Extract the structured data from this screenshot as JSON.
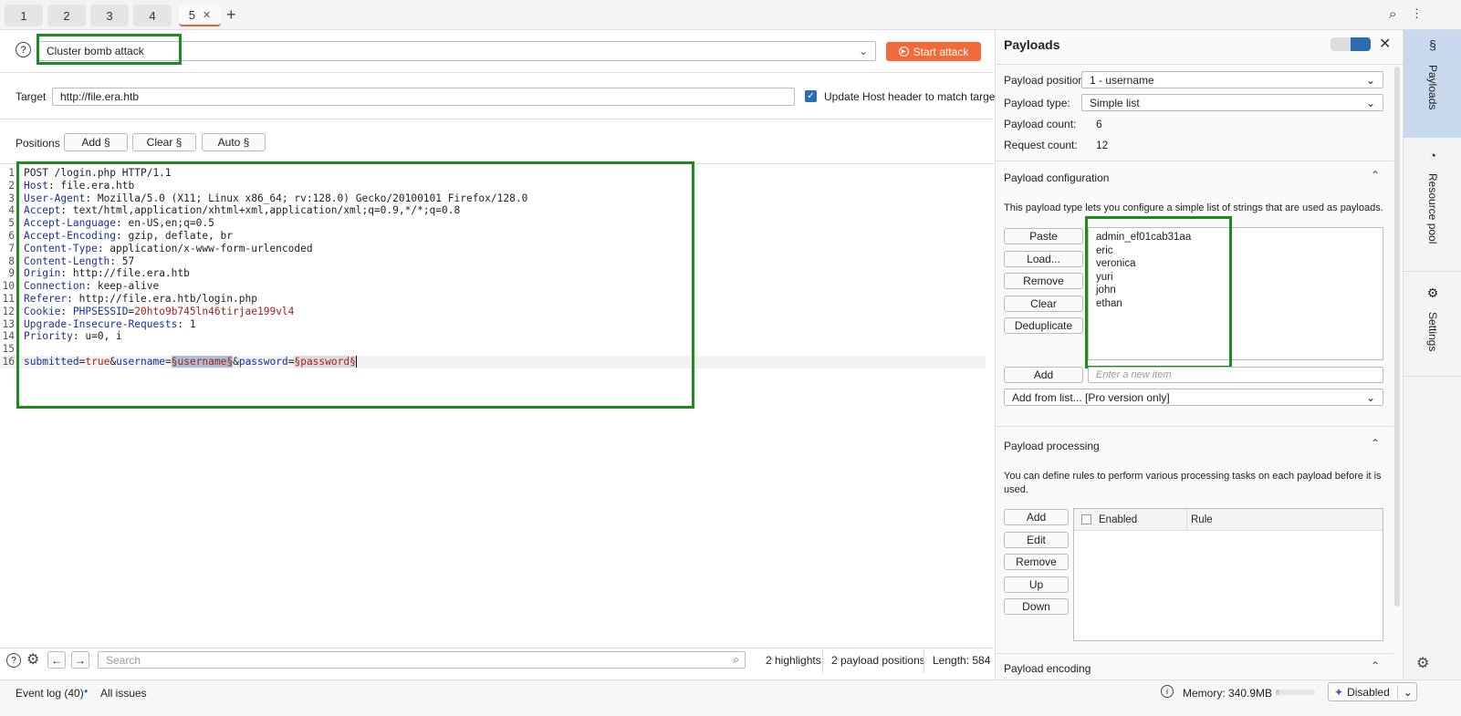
{
  "tabs": [
    {
      "label": "1"
    },
    {
      "label": "2"
    },
    {
      "label": "3"
    },
    {
      "label": "4"
    },
    {
      "label": "5",
      "active": true
    }
  ],
  "attack": {
    "type": "Cluster bomb attack",
    "start_label": "Start attack",
    "accent": "#f26a3a"
  },
  "target": {
    "label": "Target",
    "value": "http://file.era.htb",
    "update_host_label": "Update Host header to match target",
    "update_host_checked": true
  },
  "positions": {
    "label": "Positions",
    "add": "Add §",
    "clear": "Clear §",
    "auto": "Auto §"
  },
  "editor": {
    "lines": [
      [
        [
          "POST /login.php HTTP/1.1",
          "plain"
        ]
      ],
      [
        [
          "Host",
          "name"
        ],
        [
          ": file.era.htb",
          "plain"
        ]
      ],
      [
        [
          "User-Agent",
          "name"
        ],
        [
          ": Mozilla/5.0 (X11; Linux x86_64; rv:128.0) Gecko/20100101 Firefox/128.0",
          "plain"
        ]
      ],
      [
        [
          "Accept",
          "name"
        ],
        [
          ": text/html,application/xhtml+xml,application/xml;q=0.9,*/*;q=0.8",
          "plain"
        ]
      ],
      [
        [
          "Accept-Language",
          "name"
        ],
        [
          ": en-US,en;q=0.5",
          "plain"
        ]
      ],
      [
        [
          "Accept-Encoding",
          "name"
        ],
        [
          ": gzip, deflate, br",
          "plain"
        ]
      ],
      [
        [
          "Content-Type",
          "name"
        ],
        [
          ": application/x-www-form-urlencoded",
          "plain"
        ]
      ],
      [
        [
          "Content-Length",
          "name"
        ],
        [
          ": 57",
          "plain"
        ]
      ],
      [
        [
          "Origin",
          "name"
        ],
        [
          ": http://file.era.htb",
          "plain"
        ]
      ],
      [
        [
          "Connection",
          "name"
        ],
        [
          ": keep-alive",
          "plain"
        ]
      ],
      [
        [
          "Referer",
          "name"
        ],
        [
          ": http://file.era.htb/login.php",
          "plain"
        ]
      ],
      [
        [
          "Cookie",
          "name"
        ],
        [
          ": ",
          "plain"
        ],
        [
          "PHPSESSID",
          "blue"
        ],
        [
          "=",
          "plain"
        ],
        [
          "20hto9b745ln46tirjae199vl4",
          "red"
        ]
      ],
      [
        [
          "Upgrade-Insecure-Requests",
          "name"
        ],
        [
          ": 1",
          "plain"
        ]
      ],
      [
        [
          "Priority",
          "name"
        ],
        [
          ": u=0, i",
          "plain"
        ]
      ],
      [],
      [
        [
          "submitted",
          "blue"
        ],
        [
          "=",
          "plain"
        ],
        [
          "true",
          "red"
        ],
        [
          "&",
          "plain"
        ],
        [
          "username",
          "blue"
        ],
        [
          "=",
          "plain"
        ],
        [
          "§username§",
          "pos"
        ],
        [
          "&",
          "plain"
        ],
        [
          "password",
          "blue"
        ],
        [
          "=",
          "plain"
        ],
        [
          "§password§",
          "pos2"
        ]
      ]
    ]
  },
  "search": {
    "placeholder": "Search",
    "highlights": "2 highlights",
    "payload_positions": "2 payload positions",
    "length": "Length: 584"
  },
  "payloads": {
    "title": "Payloads",
    "position_label": "Payload position:",
    "position_value": "1 - username",
    "type_label": "Payload type:",
    "type_value": "Simple list",
    "count_label": "Payload count:",
    "count_value": "6",
    "request_label": "Request count:",
    "request_value": "12",
    "config": {
      "title": "Payload configuration",
      "description": "This payload type lets you configure a simple list of strings that are used as payloads.",
      "buttons": [
        "Paste",
        "Load...",
        "Remove",
        "Clear",
        "Deduplicate"
      ],
      "items": [
        "admin_ef01cab31aa",
        "eric",
        "veronica",
        "yuri",
        "john",
        "ethan"
      ],
      "add_label": "Add",
      "add_placeholder": "Enter a new item",
      "add_from_list": "Add from list... [Pro version only]"
    },
    "processing": {
      "title": "Payload processing",
      "description": "You can define rules to perform various processing tasks on each payload before it is used.",
      "buttons": [
        "Add",
        "Edit",
        "Remove",
        "Up",
        "Down"
      ],
      "columns": [
        "Enabled",
        "Rule"
      ]
    },
    "encoding": {
      "title": "Payload encoding"
    }
  },
  "sidebar": {
    "payloads": "Payloads",
    "resource_pool": "Resource pool",
    "settings": "Settings"
  },
  "status": {
    "event_log": "Event log (40)",
    "all_issues": "All issues",
    "memory": "Memory: 340.9MB",
    "memory_fraction": 0.1,
    "ai": "Disabled"
  }
}
